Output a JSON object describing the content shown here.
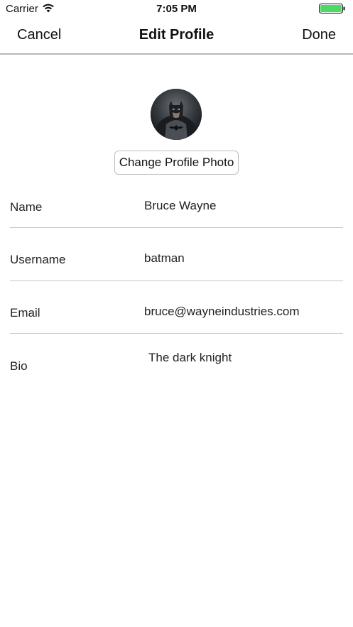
{
  "status_bar": {
    "carrier": "Carrier",
    "time": "7:05 PM",
    "battery_color": "#4cd964"
  },
  "nav": {
    "cancel_label": "Cancel",
    "title": "Edit Profile",
    "done_label": "Done"
  },
  "profile": {
    "avatar_icon": "batman-avatar",
    "change_photo_label": "Change Profile Photo"
  },
  "fields": {
    "name": {
      "label": "Name",
      "value": "Bruce Wayne"
    },
    "username": {
      "label": "Username",
      "value": "batman"
    },
    "email": {
      "label": "Email",
      "value": "bruce@wayneindustries.com"
    },
    "bio": {
      "label": "Bio",
      "value": "The dark knight"
    }
  }
}
